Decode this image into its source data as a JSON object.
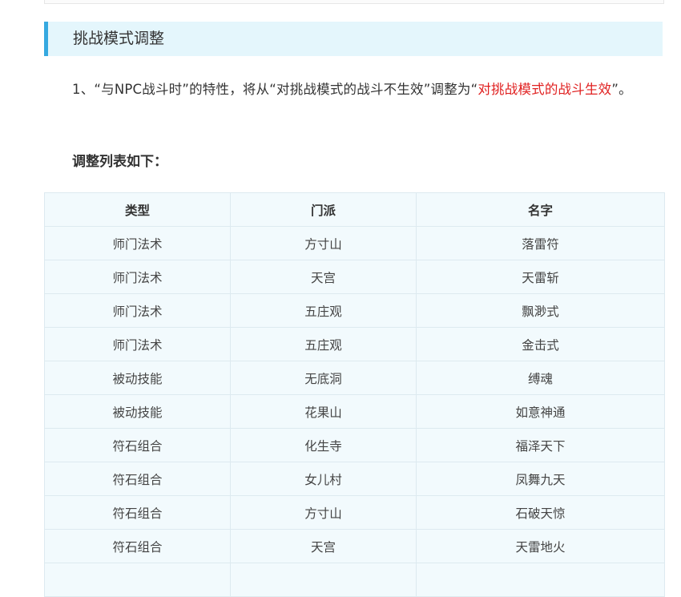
{
  "section": {
    "heading": "挑战模式调整"
  },
  "paragraph": {
    "text_before": "1、“与NPC战斗时”的特性，将从“对挑战模式的战斗不生效”调整为“",
    "highlight": "对挑战模式的战斗生效",
    "text_after": "”。",
    "highlight_color": "#e02020"
  },
  "list_title": "调整列表如下：",
  "table": {
    "headers": [
      "类型",
      "门派",
      "名字"
    ],
    "rows": [
      [
        "师门法术",
        "方寸山",
        "落雷符"
      ],
      [
        "师门法术",
        "天宫",
        "天雷斩"
      ],
      [
        "师门法术",
        "五庄观",
        "飘渺式"
      ],
      [
        "师门法术",
        "五庄观",
        "金击式"
      ],
      [
        "被动技能",
        "无底洞",
        "缚魂"
      ],
      [
        "被动技能",
        "花果山",
        "如意神通"
      ],
      [
        "符石组合",
        "化生寺",
        "福泽天下"
      ],
      [
        "符石组合",
        "女儿村",
        "凤舞九天"
      ],
      [
        "符石组合",
        "方寸山",
        "石破天惊"
      ],
      [
        "符石组合",
        "天宫",
        "天雷地火"
      ],
      [
        "",
        "",
        ""
      ]
    ]
  },
  "colors": {
    "heading_bg": "#e4f6fc",
    "heading_accent": "#36a9e0",
    "table_bg": "#f2fafd",
    "table_border": "#ddeaf0"
  }
}
